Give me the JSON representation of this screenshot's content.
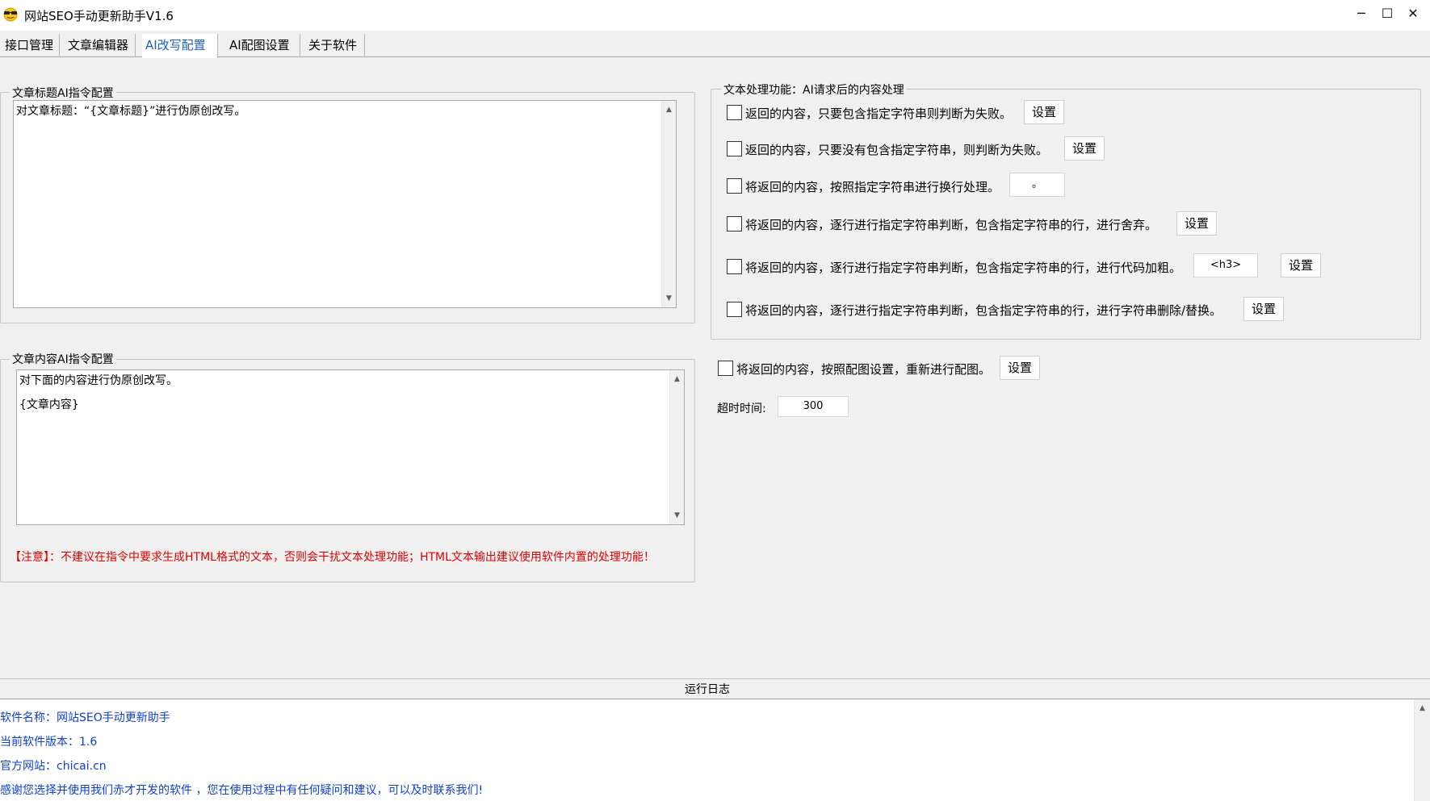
{
  "window": {
    "title": "网站SEO手动更新助手V1.6",
    "app_icon": "sunglasses-smiley-icon",
    "controls": {
      "minimize": "─",
      "maximize": "☐",
      "close": "✕"
    }
  },
  "tabs": [
    {
      "label": "接口管理",
      "active": false
    },
    {
      "label": "文章编辑器",
      "active": false
    },
    {
      "label": "AI改写配置",
      "active": true
    },
    {
      "label": "AI配图设置",
      "active": false
    },
    {
      "label": "关于软件",
      "active": false
    }
  ],
  "title_prompt": {
    "group_label": "文章标题AI指令配置",
    "text": "对文章标题：“{文章标题}”进行伪原创改写。"
  },
  "content_prompt": {
    "group_label": "文章内容AI指令配置",
    "lines": [
      "对下面的内容进行伪原创改写。",
      "{文章内容}"
    ]
  },
  "warning": "【注意】：不建议在指令中要求生成HTML格式的文本，否则会干扰文本处理功能；HTML文本输出建议使用软件内置的处理功能！",
  "processing": {
    "group_label": "文本处理功能：AI请求后的内容处理",
    "options": [
      {
        "label": "返回的内容，只要包含指定字符串则判断为失败。",
        "button": "设置",
        "checked": false
      },
      {
        "label": "返回的内容，只要没有包含指定字符串，则判断为失败。",
        "button": "设置",
        "checked": false
      },
      {
        "label": "将返回的内容，按照指定字符串进行换行处理。",
        "field": "。",
        "checked": false
      },
      {
        "label": "将返回的内容，逐行进行指定字符串判断，包含指定字符串的行，进行舍弃。",
        "button": "设置",
        "checked": false
      },
      {
        "label": "将返回的内容，逐行进行指定字符串判断，包含指定字符串的行，进行代码加粗。",
        "field": "<h3>",
        "button": "设置",
        "checked": false
      },
      {
        "label": "将返回的内容，逐行进行指定字符串判断，包含指定字符串的行，进行字符串删除/替换。",
        "button": "设置",
        "checked": false
      }
    ]
  },
  "reimage": {
    "label": "将返回的内容，按照配图设置，重新进行配图。",
    "button": "设置",
    "checked": false
  },
  "timeout": {
    "label": "超时时间:",
    "value": "300"
  },
  "log": {
    "title": "运行日志",
    "lines": [
      "软件名称：网站SEO手动更新助手",
      "当前软件版本：1.6",
      "官方网站：chicai.cn",
      "感谢您选择并使用我们赤才开发的软件 ，您在使用过程中有任何疑问和建议，可以及时联系我们!"
    ]
  },
  "colors": {
    "accent": "#1f5fbf",
    "warning": "#e00000",
    "log_text": "#1040d0"
  }
}
